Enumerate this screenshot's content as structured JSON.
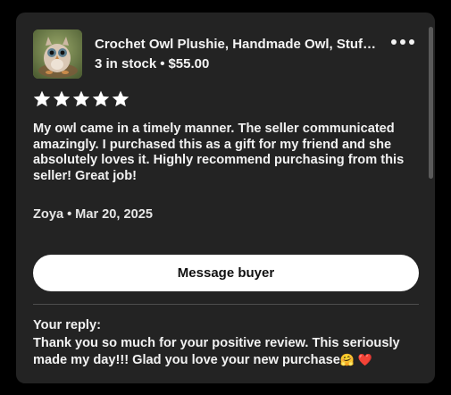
{
  "listing": {
    "title": "Crochet Owl Plushie, Handmade Owl, Stuffed Animal",
    "stock": "3 in stock",
    "price": "$55.00",
    "thumbnail_icon": "owl-plushie-photo"
  },
  "menu": {
    "icon": "more-horizontal-icon"
  },
  "review": {
    "rating": 5,
    "rating_max": 5,
    "text": "My owl came in a timely manner. The seller communicated amazingly. I purchased this as a gift for my friend and she absolutely loves it. Highly recommend purchasing from this seller! Great job!",
    "author": "Zoya",
    "date": "Mar 20, 2025"
  },
  "actions": {
    "message_buyer_label": "Message buyer"
  },
  "reply": {
    "label": "Your reply:",
    "text": "Thank you so much for your positive review. This seriously made my day!!! Glad you love your new purchase",
    "emojis": "🤗 ❤️"
  },
  "colors": {
    "page_bg": "#000000",
    "card_bg": "#232323",
    "text": "#f2f2f2",
    "button_bg": "#ffffff",
    "button_text": "#111111"
  }
}
